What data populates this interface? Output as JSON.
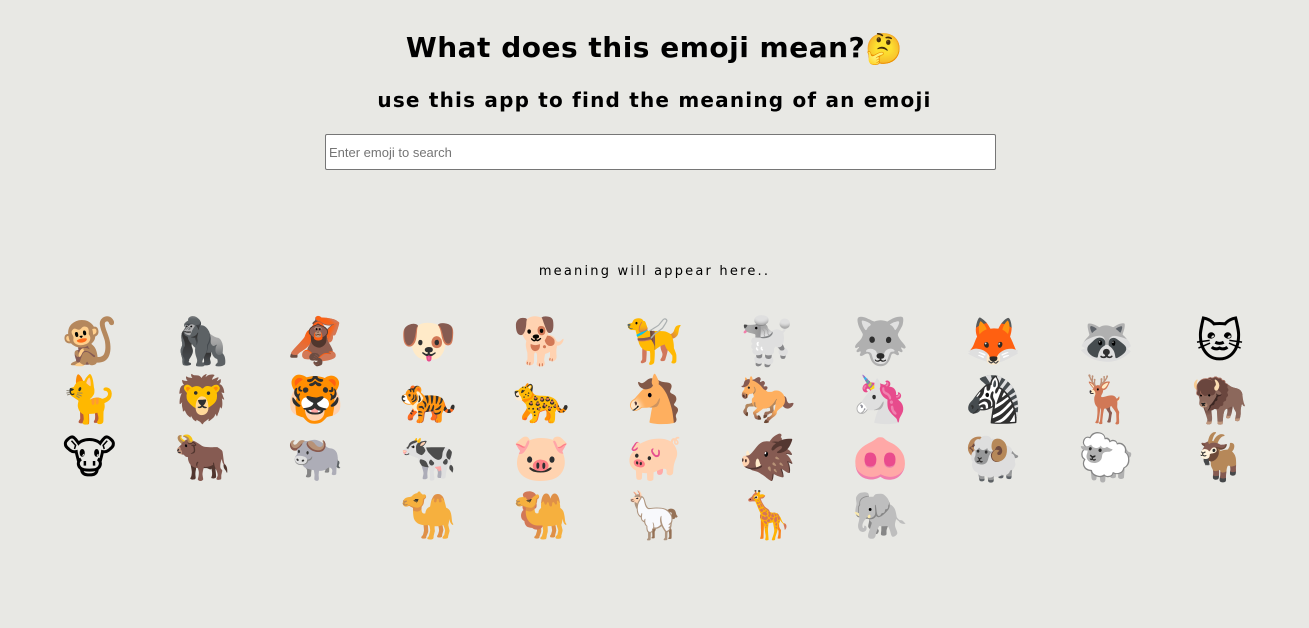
{
  "header": {
    "title": "What does this emoji mean?",
    "title_emoji": "🤔",
    "subtitle": "use this app to find the meaning of an emoji"
  },
  "search": {
    "placeholder": "Enter emoji to search",
    "value": ""
  },
  "output": {
    "meaning_text": "meaning will appear here.."
  },
  "emojis": [
    {
      "char": "🐒",
      "name": "monkey"
    },
    {
      "char": "🦍",
      "name": "gorilla"
    },
    {
      "char": "🦧",
      "name": "orangutan"
    },
    {
      "char": "🐶",
      "name": "dog-face"
    },
    {
      "char": "🐕",
      "name": "dog"
    },
    {
      "char": "🦮",
      "name": "guide-dog"
    },
    {
      "char": "🐩",
      "name": "poodle"
    },
    {
      "char": "🐺",
      "name": "wolf"
    },
    {
      "char": "🦊",
      "name": "fox"
    },
    {
      "char": "🦝",
      "name": "raccoon"
    },
    {
      "char": "🐱",
      "name": "cat-face"
    },
    {
      "char": "🐈",
      "name": "cat"
    },
    {
      "char": "🦁",
      "name": "lion"
    },
    {
      "char": "🐯",
      "name": "tiger-face"
    },
    {
      "char": "🐅",
      "name": "tiger"
    },
    {
      "char": "🐆",
      "name": "leopard"
    },
    {
      "char": "🐴",
      "name": "horse-face"
    },
    {
      "char": "🐎",
      "name": "horse"
    },
    {
      "char": "🦄",
      "name": "unicorn"
    },
    {
      "char": "🦓",
      "name": "zebra"
    },
    {
      "char": "🦌",
      "name": "deer"
    },
    {
      "char": "🦬",
      "name": "bison"
    },
    {
      "char": "🐮",
      "name": "cow-face"
    },
    {
      "char": "🐂",
      "name": "ox"
    },
    {
      "char": "🐃",
      "name": "water-buffalo"
    },
    {
      "char": "🐄",
      "name": "cow"
    },
    {
      "char": "🐷",
      "name": "pig-face"
    },
    {
      "char": "🐖",
      "name": "pig"
    },
    {
      "char": "🐗",
      "name": "boar"
    },
    {
      "char": "🐽",
      "name": "pig-nose"
    },
    {
      "char": "🐏",
      "name": "ram"
    },
    {
      "char": "🐑",
      "name": "ewe"
    },
    {
      "char": "🐐",
      "name": "goat"
    },
    {
      "char": "🐪",
      "name": "camel"
    },
    {
      "char": "🐫",
      "name": "two-hump-camel"
    },
    {
      "char": "🦙",
      "name": "llama"
    },
    {
      "char": "🦒",
      "name": "giraffe"
    },
    {
      "char": "🐘",
      "name": "elephant"
    }
  ]
}
